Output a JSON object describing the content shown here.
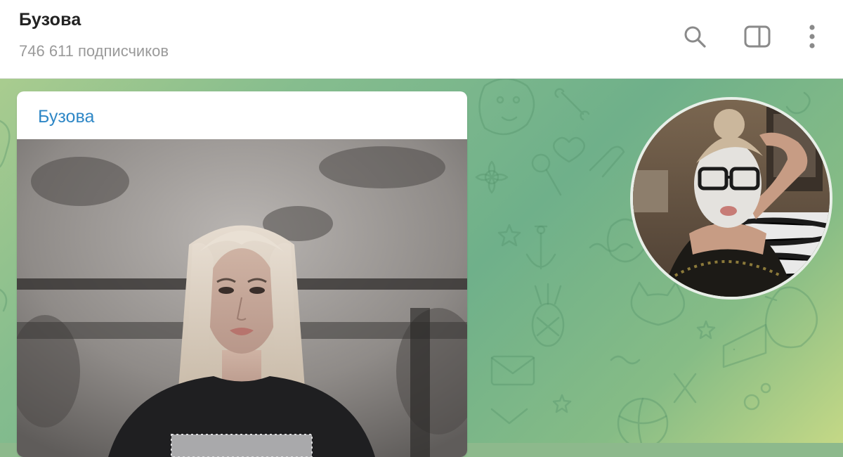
{
  "header": {
    "channel_name": "Бузова",
    "subscribers": "746 611 подписчиков",
    "actions": [
      {
        "icon": "search-icon"
      },
      {
        "icon": "sidebar-toggle-icon"
      },
      {
        "icon": "more-vertical-icon"
      }
    ]
  },
  "message": {
    "sender": "Бузова",
    "media": "photo"
  },
  "round_video": {
    "media": "round-video"
  },
  "colors": {
    "header_bg": "#ffffff",
    "title": "#222222",
    "subtitle": "#9a9a9a",
    "sender": "#2e87c6",
    "icon": "#8a8a8a",
    "chat_bg_start": "#a9cc8f",
    "chat_bg_end": "#6fb08a"
  }
}
